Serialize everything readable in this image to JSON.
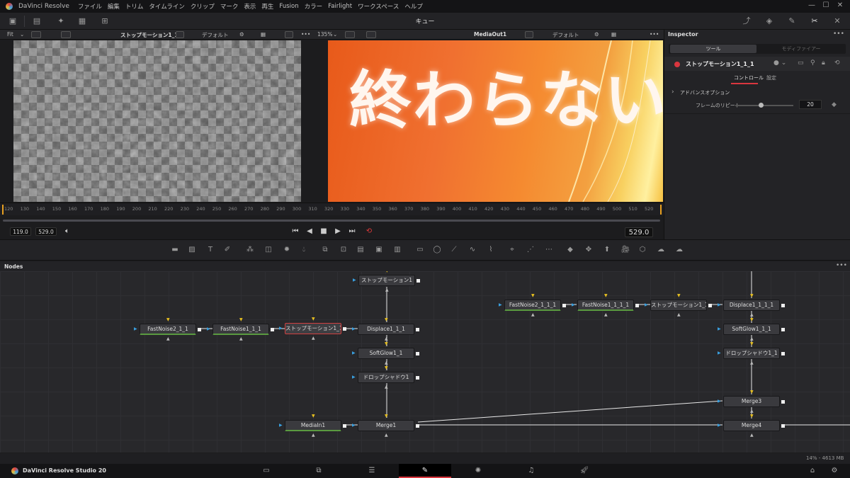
{
  "app": {
    "title": "DaVinci Resolve",
    "menus": [
      "ファイル",
      "編集",
      "トリム",
      "タイムライン",
      "クリップ",
      "マーク",
      "表示",
      "再生",
      "Fusion",
      "カラー",
      "Fairlight",
      "ワークスペース",
      "ヘルプ"
    ]
  },
  "toolbar": {
    "center_title": "キュー"
  },
  "viewer_left": {
    "fit_label": "Fit",
    "clip_name": "ストップモーション1_1_1",
    "lut_label": "デフォルト"
  },
  "viewer_right": {
    "zoom_label": "135%",
    "clip_name": "MediaOut1",
    "lut_label": "デフォルト",
    "overlay_text": "終わらない"
  },
  "ruler": {
    "ticks": [
      "120",
      "130",
      "140",
      "150",
      "160",
      "170",
      "180",
      "190",
      "200",
      "210",
      "220",
      "230",
      "240",
      "250",
      "260",
      "270",
      "280",
      "290",
      "300",
      "310",
      "320",
      "330",
      "340",
      "350",
      "360",
      "370",
      "380",
      "390",
      "400",
      "410",
      "420",
      "430",
      "440",
      "450",
      "460",
      "470",
      "480",
      "490",
      "500",
      "510",
      "520"
    ]
  },
  "transport": {
    "in_point": "119.0",
    "out_point": "529.0",
    "current_frame": "529.0"
  },
  "inspector": {
    "title": "Inspector",
    "tab_tools": "ツール",
    "tab_modifier": "モディファイアー",
    "node_name": "ストップモーション1_1_1",
    "subtab_controls": "コントロール",
    "subtab_settings": "設定",
    "section_advanced": "アドバンスオプション",
    "param_label": "フレームのリピート",
    "param_value": "20",
    "param_level": 0.44
  },
  "nodes_panel": {
    "title": "Nodes",
    "nodes": [
      "ストップモーション1",
      "FastNoise2_1_1",
      "FastNoise1_1_1",
      "ストップモーション1_1_1",
      "Displace1_1_1",
      "SoftGlow1_1",
      "ドロップシャドウ1",
      "MediaIn1",
      "Merge1",
      "FastNoise2_1_1_1",
      "FastNoise1_1_1_1",
      "ストップモーション1_1_1_1",
      "Displace1_1_1_1",
      "SoftGlow1_1_1",
      "ドロップシャドウ1_1",
      "Merge3",
      "Merge4"
    ]
  },
  "status": {
    "memory": "14% - 4613 MB"
  },
  "pagebar": {
    "product": "DaVinci Resolve Studio 20"
  },
  "colors": {
    "accent_red": "#d9363e",
    "connector_yellow": "#e8c020",
    "connector_green": "#5aba40",
    "connector_blue": "#3aa0e0"
  }
}
